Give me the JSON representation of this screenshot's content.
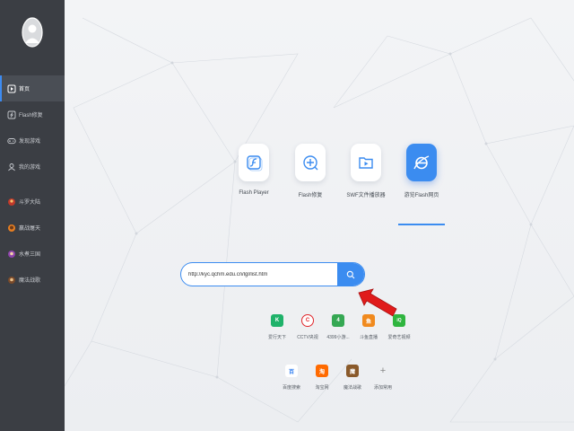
{
  "sidebar": {
    "items": [
      {
        "label": "首页",
        "icon": "play-square-icon",
        "active": true
      },
      {
        "label": "Flash修复",
        "icon": "flash-icon",
        "active": false
      },
      {
        "label": "发现游戏",
        "icon": "gamepad-icon",
        "active": false
      },
      {
        "label": "我的游戏",
        "icon": "user-icon",
        "active": false
      },
      {
        "label": "斗罗大陆",
        "icon": "game-avatar-icon",
        "active": false
      },
      {
        "label": "赢战屠天",
        "icon": "game-avatar-icon",
        "active": false
      },
      {
        "label": "水煮三国",
        "icon": "game-avatar-icon",
        "active": false
      },
      {
        "label": "魔法战歌",
        "icon": "game-avatar-icon",
        "active": false
      }
    ]
  },
  "tiles": [
    {
      "label": "Flash Player",
      "icon": "flash-player-icon"
    },
    {
      "label": "Flash修复",
      "icon": "repair-plus-icon"
    },
    {
      "label": "SWF文件播放器",
      "icon": "swf-folder-play-icon"
    },
    {
      "label": "游览Flash网页",
      "icon": "ie-browser-icon"
    }
  ],
  "search": {
    "value": "http://kyc.qchm.edu.cn/lgl/list.htm"
  },
  "shortcuts": [
    {
      "label": "爱行天下",
      "letter": "K",
      "color": "#1fb26a"
    },
    {
      "label": "CCTV央视",
      "letter": "C",
      "color": "#e0262b"
    },
    {
      "label": "4399小游...",
      "letter": "4",
      "color": "#35a853"
    },
    {
      "label": "斗鱼直播",
      "letter": "鱼",
      "color": "#f08a1e"
    },
    {
      "label": "爱奇艺视频",
      "letter": "iQ",
      "color": "#2fb53f"
    },
    {
      "label": "百度搜索",
      "letter": "百",
      "color": "#2d7cf0"
    },
    {
      "label": "淘宝网",
      "letter": "淘",
      "color": "#ff6a00"
    },
    {
      "label": "魔法战歌",
      "letter": "魔",
      "color": "#8a5a2b"
    },
    {
      "label": "添加常用",
      "letter": "+",
      "color": "transparent"
    }
  ],
  "colors": {
    "accent": "#3b8cf0",
    "sidebar_bg": "#3b3e44",
    "arrow": "#e01b1b"
  }
}
